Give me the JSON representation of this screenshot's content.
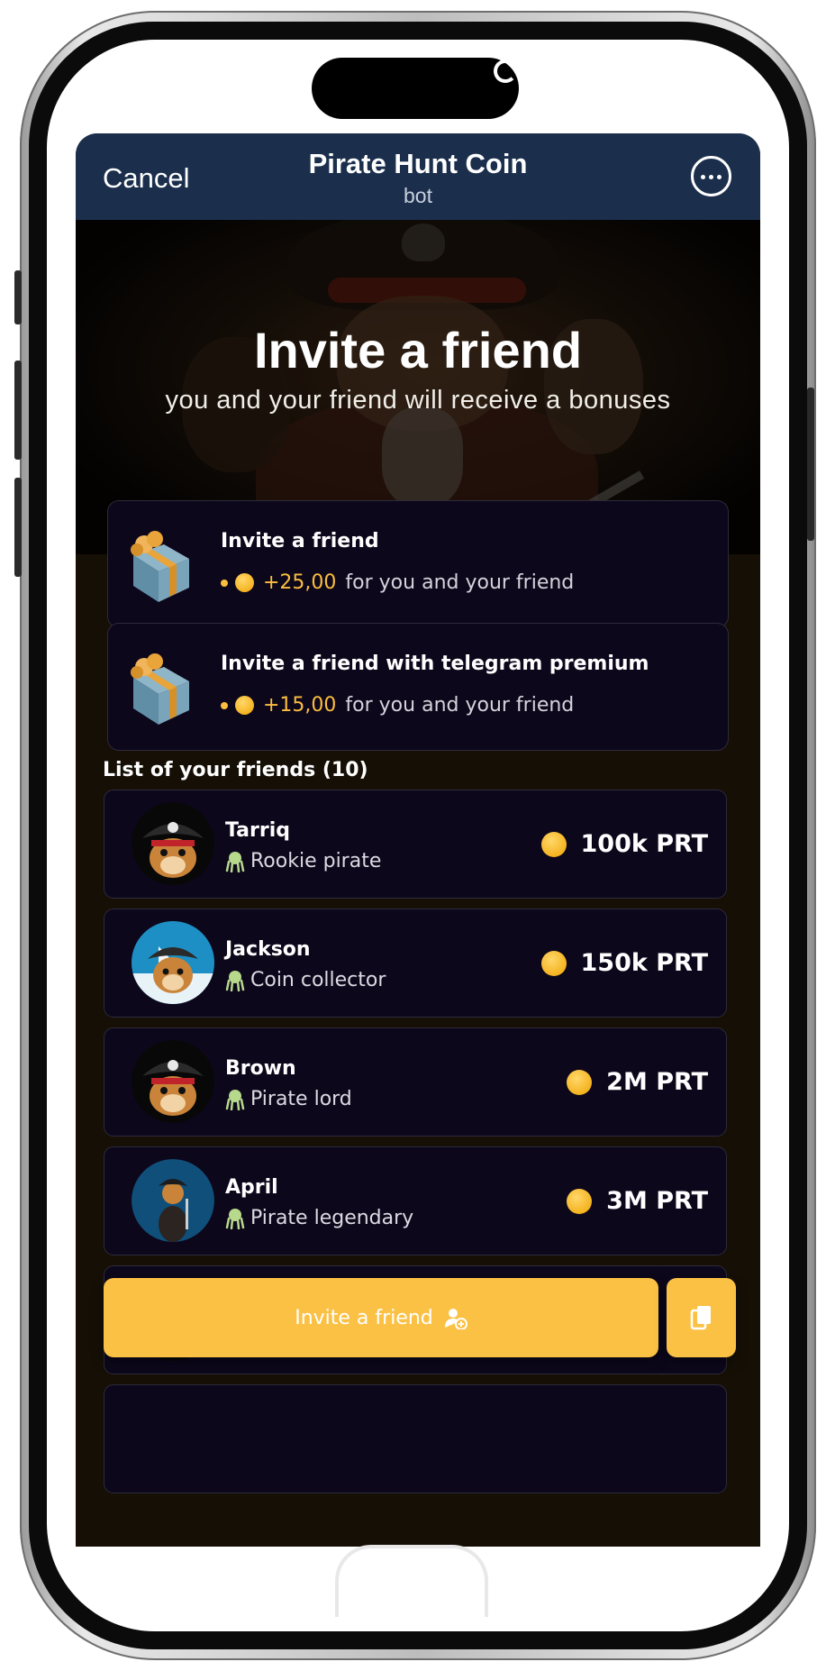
{
  "header": {
    "cancel_label": "Cancel",
    "title": "Pirate Hunt Coin",
    "subtitle": "bot",
    "menu_icon": "more-icon",
    "background_color": "#1b2f4d"
  },
  "hero": {
    "title": "Invite a friend",
    "subtitle": "you and your friend will receive a bonuses"
  },
  "bonuses": [
    {
      "title": "Invite a friend",
      "amount": "+25,00",
      "description": "for you and your friend",
      "icon": "gift-icon"
    },
    {
      "title": "Invite a friend with telegram premium",
      "amount": "+15,00",
      "description": "for you and your friend",
      "icon": "gift-icon"
    }
  ],
  "friends": {
    "title": "List of your friends (10)",
    "items": [
      {
        "name": "Tarriq",
        "rank": "Rookie pirate",
        "amount": "100k PRT",
        "avatar": "pirate-dog-avatar"
      },
      {
        "name": "Jackson",
        "rank": "Coin collector",
        "amount": "150k PRT",
        "avatar": "pirate-dog-ship-avatar"
      },
      {
        "name": "Brown",
        "rank": "Pirate lord",
        "amount": "2M PRT",
        "avatar": "pirate-dog-avatar"
      },
      {
        "name": "April",
        "rank": "Pirate legendary",
        "amount": "3M PRT",
        "avatar": "pirate-dog-sword-avatar"
      }
    ]
  },
  "actions": {
    "invite_label": "Invite a friend",
    "invite_icon": "add-user-icon",
    "copy_icon": "copy-icon"
  },
  "colors": {
    "accent": "#fbc145",
    "coin": "#f5b320",
    "card_bg": "#0d071b",
    "page_bg": "#150f06"
  }
}
